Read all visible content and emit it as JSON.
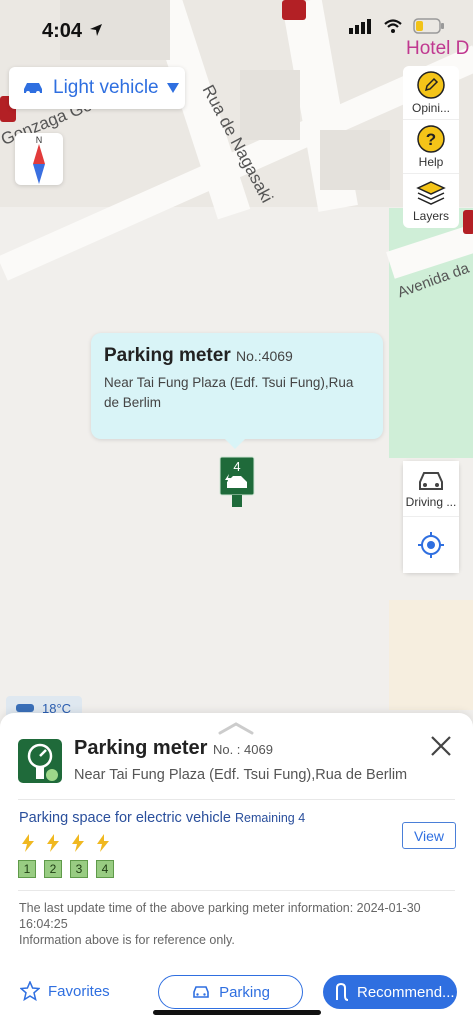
{
  "status_bar": {
    "time": "4:04"
  },
  "map": {
    "hotel_label": "Hotel D",
    "street_nagasaki": "Rua de Nagasaki",
    "street_gonzaga": "Gonzaga Gom",
    "street_avenida": "Avenida da",
    "vehicle_select": {
      "label": "Light vehicle"
    },
    "compass_n": "N",
    "temperature": "18°C"
  },
  "side_tools": {
    "opinion": "Opini...",
    "help": "Help",
    "layers": "Layers",
    "driving": "Driving ..."
  },
  "popup": {
    "title": "Parking meter",
    "number": "No.:4069",
    "address": "Near Tai Fung Plaza (Edf. Tsui Fung),Rua de Berlim"
  },
  "marker": {
    "count": "4"
  },
  "sheet": {
    "title": "Parking meter",
    "number": "No. : 4069",
    "address": "Near Tai Fung Plaza (Edf. Tsui Fung),Rua de Berlim",
    "ev_title": "Parking space for electric vehicle",
    "ev_remaining": "Remaining 4",
    "view_label": "View",
    "spaces": [
      "1",
      "2",
      "3",
      "4"
    ],
    "note_line1": "The last update time of the above parking meter information: 2024-01-30",
    "note_line2": "16:04:25",
    "note_line3": "Information above is for reference only."
  },
  "bottom_bar": {
    "favorites": "Favorites",
    "parking": "Parking",
    "recommend": "Recommend..."
  },
  "colors": {
    "accent": "#2f6fe0",
    "meter_green": "#1f6a3a",
    "popup_bg": "#d9f4f7"
  }
}
